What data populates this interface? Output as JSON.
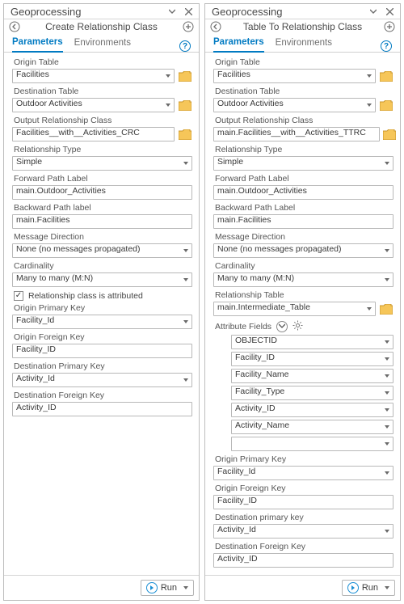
{
  "tabs": {
    "parameters": "Parameters",
    "environments": "Environments"
  },
  "run_label": "Run",
  "left": {
    "pane_title": "Geoprocessing",
    "tool_title": "Create Relationship Class",
    "fields": {
      "origin_table_lbl": "Origin Table",
      "origin_table_val": "Facilities",
      "dest_table_lbl": "Destination Table",
      "dest_table_val": "Outdoor Activities",
      "out_rc_lbl": "Output Relationship Class",
      "out_rc_val": "Facilities__with__Activities_CRC",
      "rel_type_lbl": "Relationship Type",
      "rel_type_val": "Simple",
      "fwd_lbl": "Forward Path Label",
      "fwd_val": "main.Outdoor_Activities",
      "bwd_lbl": "Backward Path label",
      "bwd_val": "main.Facilities",
      "msg_lbl": "Message Direction",
      "msg_val": "None (no messages propagated)",
      "card_lbl": "Cardinality",
      "card_val": "Many to many (M:N)",
      "attr_check": "Relationship class is attributed",
      "opk_lbl": "Origin Primary Key",
      "opk_val": "Facility_Id",
      "ofk_lbl": "Origin Foreign Key",
      "ofk_val": "Facility_ID",
      "dpk_lbl": "Destination Primary Key",
      "dpk_val": "Activity_Id",
      "dfk_lbl": "Destination Foreign Key",
      "dfk_val": "Activity_ID"
    }
  },
  "right": {
    "pane_title": "Geoprocessing",
    "tool_title": "Table To Relationship Class",
    "fields": {
      "origin_table_lbl": "Origin Table",
      "origin_table_val": "Facilities",
      "dest_table_lbl": "Destination Table",
      "dest_table_val": "Outdoor Activities",
      "out_rc_lbl": "Output Relationship Class",
      "out_rc_val": "main.Facilities__with__Activities_TTRC",
      "rel_type_lbl": "Relationship Type",
      "rel_type_val": "Simple",
      "fwd_lbl": "Forward Path Label",
      "fwd_val": "main.Outdoor_Activities",
      "bwd_lbl": "Backward Path Label",
      "bwd_val": "main.Facilities",
      "msg_lbl": "Message Direction",
      "msg_val": "None (no messages propagated)",
      "card_lbl": "Cardinality",
      "card_val": "Many to many (M:N)",
      "rel_table_lbl": "Relationship Table",
      "rel_table_val": "main.Intermediate_Table",
      "attr_fields_lbl": "Attribute Fields",
      "attr_fields": [
        "OBJECTID",
        "Facility_ID",
        "Facility_Name",
        "Facility_Type",
        "Activity_ID",
        "Activity_Name"
      ],
      "opk_lbl": "Origin Primary Key",
      "opk_val": "Facility_Id",
      "ofk_lbl": "Origin Foreign Key",
      "ofk_val": "Facility_ID",
      "dpk_lbl": "Destination primary key",
      "dpk_val": "Activity_Id",
      "dfk_lbl": "Destination Foreign Key",
      "dfk_val": "Activity_ID"
    }
  }
}
